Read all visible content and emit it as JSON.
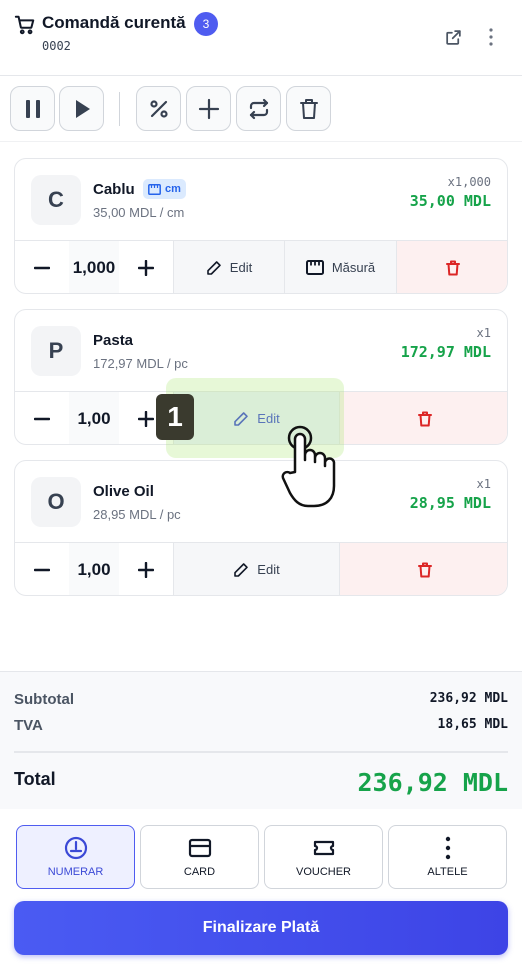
{
  "header": {
    "title": "Comandă curentă",
    "item_count": "3",
    "order_number": "0002"
  },
  "toolbar": {
    "buttons": [
      "pause-icon",
      "play-icon",
      "percent-icon",
      "plus-icon",
      "swap-icon",
      "trash-icon"
    ]
  },
  "items": [
    {
      "initial": "C",
      "name": "Cablu",
      "unit_badge": "cm",
      "price": "35,00 MDL / cm",
      "qty_tag": "x1,000",
      "line_total": "35,00 MDL",
      "quantity": "1,000",
      "edit_label": "Edit",
      "measure_label": "Măsură"
    },
    {
      "initial": "P",
      "name": "Pasta",
      "price": "172,97 MDL / pc",
      "qty_tag": "x1",
      "line_total": "172,97 MDL",
      "quantity": "1,00",
      "edit_label": "Edit"
    },
    {
      "initial": "O",
      "name": "Olive Oil",
      "price": "28,95 MDL / pc",
      "qty_tag": "x1",
      "line_total": "28,95 MDL",
      "quantity": "1,00",
      "edit_label": "Edit"
    }
  ],
  "totals": {
    "subtotal_label": "Subtotal",
    "subtotal_value": "236,92 MDL",
    "tva_label": "TVA",
    "tva_value": "18,65 MDL",
    "total_label": "Total",
    "total_value": "236,92 MDL"
  },
  "payment_methods": [
    {
      "label": "NUMERAR",
      "icon": "cash-icon",
      "selected": true
    },
    {
      "label": "CARD",
      "icon": "card-icon",
      "selected": false
    },
    {
      "label": "VOUCHER",
      "icon": "voucher-icon",
      "selected": false
    },
    {
      "label": "ALTELE",
      "icon": "more-vertical-icon",
      "selected": false
    }
  ],
  "finalize_label": "Finalizare Plată",
  "tutorial": {
    "step_number": "1"
  },
  "colors": {
    "accent": "#4f5cf0",
    "price_green": "#16a34a",
    "delete_red": "#dc2626",
    "highlight": "#aae66e"
  }
}
